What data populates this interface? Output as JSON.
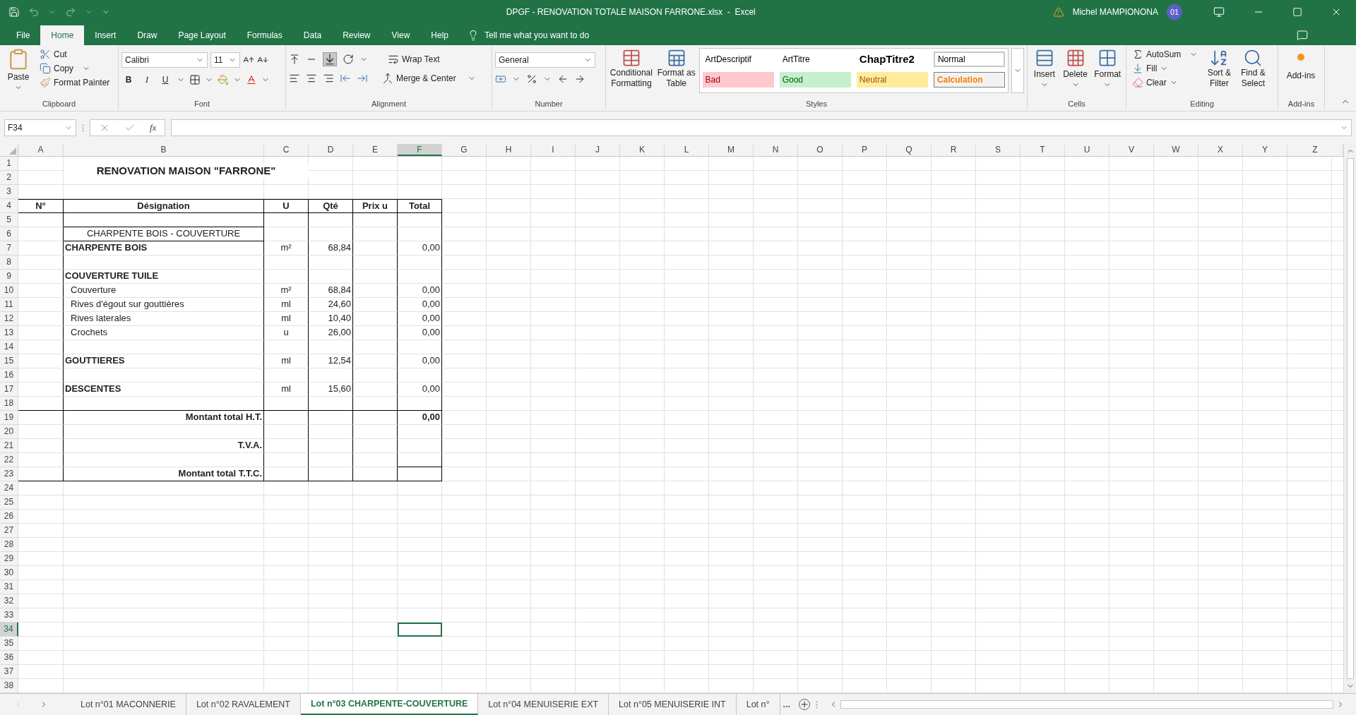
{
  "title_bar": {
    "title": "DPGF - RENOVATION TOTALE MAISON FARRONE.xlsx  -  Excel",
    "user": "Michel MAMPIONONA",
    "avatar": "01"
  },
  "menu_tabs": [
    {
      "label": "File",
      "selected": false
    },
    {
      "label": "Home",
      "selected": true
    },
    {
      "label": "Insert",
      "selected": false
    },
    {
      "label": "Draw",
      "selected": false
    },
    {
      "label": "Page Layout",
      "selected": false
    },
    {
      "label": "Formulas",
      "selected": false
    },
    {
      "label": "Data",
      "selected": false
    },
    {
      "label": "Review",
      "selected": false
    },
    {
      "label": "View",
      "selected": false
    },
    {
      "label": "Help",
      "selected": false
    }
  ],
  "tell_me": "Tell me what you want to do",
  "ribbon": {
    "clipboard": {
      "label": "Clipboard",
      "paste": "Paste",
      "cut": "Cut",
      "copy": "Copy",
      "format_painter": "Format Painter"
    },
    "font": {
      "label": "Font",
      "font_name": "Calibri",
      "font_size": "11",
      "bold": "B",
      "italic": "I",
      "underline": "U"
    },
    "alignment": {
      "label": "Alignment",
      "wrap_text": "Wrap Text",
      "merge_center": "Merge & Center"
    },
    "number": {
      "label": "Number",
      "format": "General"
    },
    "styles": {
      "label": "Styles",
      "conditional_formatting": "Conditional Formatting",
      "format_as_table": "Format as Table",
      "gallery": [
        {
          "label": "ArtDescriptif",
          "kind": "plain"
        },
        {
          "label": "ArtTitre",
          "kind": "plain"
        },
        {
          "label": "ChapTitre2",
          "kind": "heading"
        },
        {
          "label": "Normal",
          "kind": "normal"
        },
        {
          "label": "Bad",
          "kind": "bad"
        },
        {
          "label": "Good",
          "kind": "good"
        },
        {
          "label": "Neutral",
          "kind": "neutral"
        },
        {
          "label": "Calculation",
          "kind": "calculation"
        }
      ]
    },
    "cells": {
      "label": "Cells",
      "insert": "Insert",
      "delete": "Delete",
      "format": "Format"
    },
    "editing": {
      "label": "Editing",
      "autosum": "AutoSum",
      "fill": "Fill",
      "clear": "Clear",
      "sort_filter": "Sort & Filter",
      "find_select": "Find & Select"
    },
    "addins": {
      "label": "Add-ins",
      "button": "Add-ins"
    }
  },
  "formula_bar": {
    "name_box": "F34",
    "function": "fx"
  },
  "sheet": {
    "columns": [
      {
        "label": "A",
        "selected": false
      },
      {
        "label": "B",
        "selected": false
      },
      {
        "label": "C",
        "selected": false
      },
      {
        "label": "D",
        "selected": false
      },
      {
        "label": "E",
        "selected": false
      },
      {
        "label": "F",
        "selected": true
      },
      {
        "label": "G",
        "selected": false
      },
      {
        "label": "H",
        "selected": false
      },
      {
        "label": "I",
        "selected": false
      },
      {
        "label": "J",
        "selected": false
      },
      {
        "label": "K",
        "selected": false
      },
      {
        "label": "L",
        "selected": false
      },
      {
        "label": "M",
        "selected": false
      },
      {
        "label": "N",
        "selected": false
      },
      {
        "label": "O",
        "selected": false
      },
      {
        "label": "P",
        "selected": false
      },
      {
        "label": "Q",
        "selected": false
      },
      {
        "label": "R",
        "selected": false
      },
      {
        "label": "S",
        "selected": false
      },
      {
        "label": "T",
        "selected": false
      },
      {
        "label": "U",
        "selected": false
      },
      {
        "label": "V",
        "selected": false
      },
      {
        "label": "W",
        "selected": false
      },
      {
        "label": "X",
        "selected": false
      },
      {
        "label": "Y",
        "selected": false
      },
      {
        "label": "Z",
        "selected": false
      }
    ],
    "rows": [
      {
        "number": "1",
        "selected": false,
        "cells": {
          "B": {
            "text": "RENOVATION MAISON \"FARRONE\"",
            "kind": "title"
          }
        }
      },
      {
        "number": "2",
        "selected": false
      },
      {
        "number": "3",
        "selected": false
      },
      {
        "number": "4",
        "selected": false,
        "cells": {
          "A": {
            "text": "N°",
            "kind": "header"
          },
          "B": {
            "text": "Désignation",
            "kind": "header"
          },
          "C": {
            "text": "U",
            "kind": "header"
          },
          "D": {
            "text": "Qté",
            "kind": "header"
          },
          "E": {
            "text": "Prix u",
            "kind": "header"
          },
          "F": {
            "text": "Total",
            "kind": "header"
          }
        }
      },
      {
        "number": "5",
        "selected": false
      },
      {
        "number": "6",
        "selected": false,
        "cells": {
          "B": {
            "text": "CHARPENTE BOIS - COUVERTURE",
            "kind": "chapter"
          }
        }
      },
      {
        "number": "7",
        "selected": false,
        "cells": {
          "B": {
            "text": "CHARPENTE BOIS",
            "kind": "section"
          },
          "C": {
            "text": "m²",
            "kind": "unit"
          },
          "D": {
            "text": "68,84",
            "kind": "number"
          },
          "F": {
            "text": "0,00",
            "kind": "number"
          }
        }
      },
      {
        "number": "8",
        "selected": false
      },
      {
        "number": "9",
        "selected": false,
        "cells": {
          "B": {
            "text": "COUVERTURE TUILE",
            "kind": "section"
          }
        }
      },
      {
        "number": "10",
        "selected": false,
        "cells": {
          "B": {
            "text": "Couverture",
            "kind": "item"
          },
          "C": {
            "text": "m²",
            "kind": "unit"
          },
          "D": {
            "text": "68,84",
            "kind": "number"
          },
          "F": {
            "text": "0,00",
            "kind": "number"
          }
        }
      },
      {
        "number": "11",
        "selected": false,
        "cells": {
          "B": {
            "text": "Rives d'égout sur gouttières",
            "kind": "item"
          },
          "C": {
            "text": "ml",
            "kind": "unit"
          },
          "D": {
            "text": "24,60",
            "kind": "number"
          },
          "F": {
            "text": "0,00",
            "kind": "number"
          }
        }
      },
      {
        "number": "12",
        "selected": false,
        "cells": {
          "B": {
            "text": "Rives laterales",
            "kind": "item"
          },
          "C": {
            "text": "ml",
            "kind": "unit"
          },
          "D": {
            "text": "10,40",
            "kind": "number"
          },
          "F": {
            "text": "0,00",
            "kind": "number"
          }
        }
      },
      {
        "number": "13",
        "selected": false,
        "cells": {
          "B": {
            "text": "Crochets",
            "kind": "item"
          },
          "C": {
            "text": "u",
            "kind": "unit"
          },
          "D": {
            "text": "26,00",
            "kind": "number"
          },
          "F": {
            "text": "0,00",
            "kind": "number"
          }
        }
      },
      {
        "number": "14",
        "selected": false
      },
      {
        "number": "15",
        "selected": false,
        "cells": {
          "B": {
            "text": "GOUTTIERES",
            "kind": "section"
          },
          "C": {
            "text": "ml",
            "kind": "unit"
          },
          "D": {
            "text": "12,54",
            "kind": "number"
          },
          "F": {
            "text": "0,00",
            "kind": "number"
          }
        }
      },
      {
        "number": "16",
        "selected": false
      },
      {
        "number": "17",
        "selected": false,
        "cells": {
          "B": {
            "text": "DESCENTES",
            "kind": "section"
          },
          "C": {
            "text": "ml",
            "kind": "unit"
          },
          "D": {
            "text": "15,60",
            "kind": "number"
          },
          "F": {
            "text": "0,00",
            "kind": "number"
          }
        }
      },
      {
        "number": "18",
        "selected": false
      },
      {
        "number": "19",
        "selected": false,
        "cells": {
          "B": {
            "text": "Montant total H.T.",
            "kind": "total-label"
          },
          "F": {
            "text": "0,00",
            "kind": "total"
          }
        }
      },
      {
        "number": "20",
        "selected": false
      },
      {
        "number": "21",
        "selected": false,
        "cells": {
          "B": {
            "text": "T.V.A.",
            "kind": "total-label"
          }
        }
      },
      {
        "number": "22",
        "selected": false
      },
      {
        "number": "23",
        "selected": false,
        "cells": {
          "B": {
            "text": "Montant total T.T.C.",
            "kind": "total-label"
          }
        }
      },
      {
        "number": "24",
        "selected": false
      },
      {
        "number": "25",
        "selected": false
      },
      {
        "number": "26",
        "selected": false
      },
      {
        "number": "27",
        "selected": false
      },
      {
        "number": "28",
        "selected": false
      },
      {
        "number": "29",
        "selected": false
      },
      {
        "number": "30",
        "selected": false
      },
      {
        "number": "31",
        "selected": false
      },
      {
        "number": "32",
        "selected": false
      },
      {
        "number": "33",
        "selected": false
      },
      {
        "number": "34",
        "selected": true
      },
      {
        "number": "35",
        "selected": false
      },
      {
        "number": "36",
        "selected": false
      },
      {
        "number": "37",
        "selected": false
      },
      {
        "number": "38",
        "selected": false
      }
    ]
  },
  "sheet_tabs": [
    {
      "label": "Lot n°01 MACONNERIE",
      "selected": false
    },
    {
      "label": "Lot n°02 RAVALEMENT",
      "selected": false
    },
    {
      "label": "Lot n°03 CHARPENTE-COUVERTURE",
      "selected": true
    },
    {
      "label": "Lot n°04 MENUISERIE EXT",
      "selected": false
    },
    {
      "label": "Lot n°05 MENUISERIE INT",
      "selected": false
    },
    {
      "label": "Lot n°",
      "selected": false
    }
  ],
  "more_tabs": "..."
}
